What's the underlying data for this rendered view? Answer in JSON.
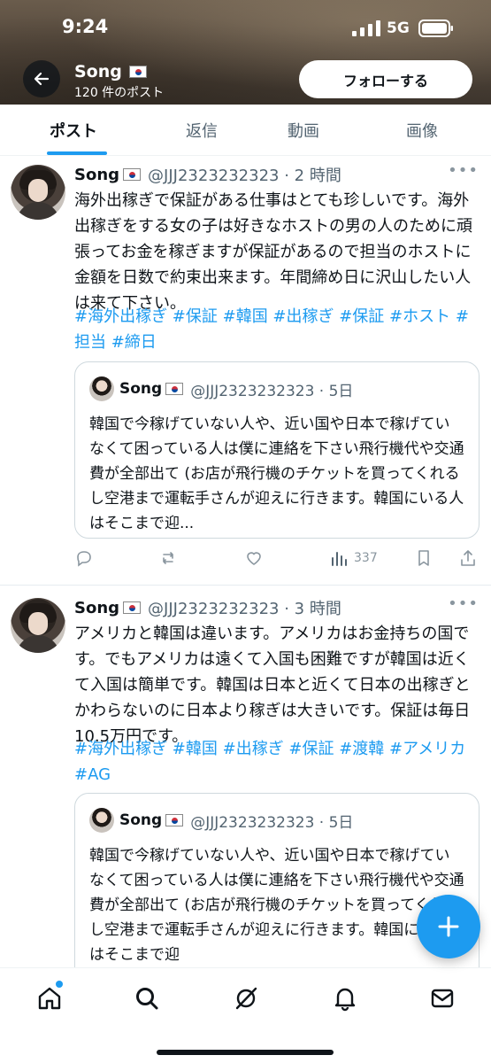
{
  "status_bar": {
    "time": "9:24",
    "network": "5G"
  },
  "header": {
    "name": "Song",
    "post_count": "120 件のポスト",
    "follow_label": "フォローする"
  },
  "tabs": [
    {
      "label": "ポスト",
      "active": true
    },
    {
      "label": "返信",
      "active": false
    },
    {
      "label": "動画",
      "active": false
    },
    {
      "label": "画像",
      "active": false
    }
  ],
  "posts": [
    {
      "name": "Song",
      "handle": "@JJJ2323232323 · 2 時間",
      "text": "海外出稼ぎで保証がある仕事はとても珍しいです。海外出稼ぎをする女の子は好きなホストの男の人のために頑張ってお金を稼ぎますが保証があるので担当のホストに金額を日数で約束出来ます。年間締め日に沢山したい人は来て下さい。",
      "hashtags": "#海外出稼ぎ  #保証  #韓国  #出稼ぎ  #保証  #ホスト  #担当  #締日",
      "quote": {
        "name": "Song",
        "handle": "@JJJ2323232323 · 5日",
        "text": "韓国で今稼げていない人や、近い国や日本で稼げていなくて困っている人は僕に連絡を下さい飛行機代や交通費が全部出て (お店が飛行機のチケットを買ってくれるし空港まで運転手さんが迎えに行きます。韓国にいる人はそこまで迎..."
      },
      "views": "337"
    },
    {
      "name": "Song",
      "handle": "@JJJ2323232323 · 3 時間",
      "text": "アメリカと韓国は違います。アメリカはお金持ちの国です。でもアメリカは遠くて入国も困難ですが韓国は近くて入国は簡単です。韓国は日本と近くて日本の出稼ぎとかわらないのに日本より稼ぎは大きいです。保証は毎日10.5万円です。",
      "hashtags": "#海外出稼ぎ  #韓国  #出稼ぎ  #保証  #渡韓  #アメリカ  #AG",
      "quote": {
        "name": "Song",
        "handle": "@JJJ2323232323 · 5日",
        "text": "韓国で今稼げていない人や、近い国や日本で稼げていなくて困っている人は僕に連絡を下さい飛行機代や交通費が全部出て (お店が飛行機のチケットを買ってくれるし空港まで運転手さんが迎えに行きます。韓国にいる人はそこまで迎"
      }
    }
  ],
  "colors": {
    "accent": "#1d9bf0",
    "text": "#0f1419",
    "muted": "#536471"
  }
}
